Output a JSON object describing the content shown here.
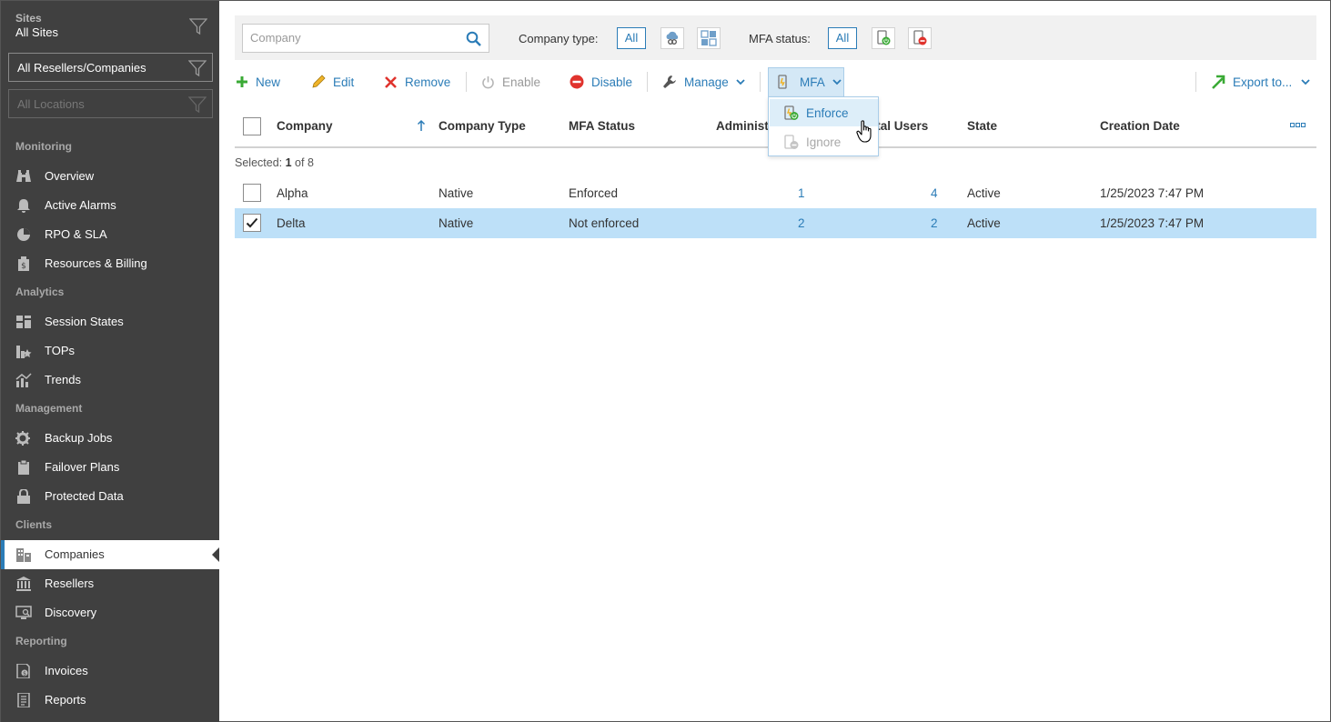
{
  "sidebar": {
    "sites_label": "Sites",
    "sites_value": "All Sites",
    "reseller_select": "All Resellers/Companies",
    "location_select": "All Locations",
    "sections": {
      "monitoring": "Monitoring",
      "analytics": "Analytics",
      "management": "Management",
      "clients": "Clients",
      "reporting": "Reporting"
    },
    "items": {
      "overview": "Overview",
      "active_alarms": "Active Alarms",
      "rpo_sla": "RPO & SLA",
      "resources_billing": "Resources & Billing",
      "session_states": "Session States",
      "tops": "TOPs",
      "trends": "Trends",
      "backup_jobs": "Backup Jobs",
      "failover_plans": "Failover Plans",
      "protected_data": "Protected Data",
      "companies": "Companies",
      "resellers": "Resellers",
      "discovery": "Discovery",
      "invoices": "Invoices",
      "reports": "Reports"
    },
    "active_item": "Companies"
  },
  "filters": {
    "search_placeholder": "Company",
    "company_type_label": "Company type:",
    "company_type_all": "All",
    "mfa_status_label": "MFA status:",
    "mfa_status_all": "All"
  },
  "toolbar": {
    "new": "New",
    "edit": "Edit",
    "remove": "Remove",
    "enable": "Enable",
    "disable": "Disable",
    "manage": "Manage",
    "mfa": "MFA",
    "export": "Export to..."
  },
  "mfa_menu": {
    "enforce": "Enforce",
    "ignore": "Ignore"
  },
  "table": {
    "headers": {
      "company": "Company",
      "company_type": "Company Type",
      "mfa_status": "MFA Status",
      "administrators": "Administ",
      "portal_users": "rtal Users",
      "state": "State",
      "creation_date": "Creation Date"
    },
    "selected_prefix": "Selected:",
    "selected_count": "1",
    "selected_suffix": "of 8",
    "rows": [
      {
        "company": "Alpha",
        "type": "Native",
        "mfa": "Enforced",
        "admins": "1",
        "users": "4",
        "state": "Active",
        "created": "1/25/2023 7:47 PM",
        "selected": false
      },
      {
        "company": "Delta",
        "type": "Native",
        "mfa": "Not enforced",
        "admins": "2",
        "users": "2",
        "state": "Active",
        "created": "1/25/2023 7:47 PM",
        "selected": true
      }
    ]
  },
  "colors": {
    "accent": "#2b7cb7",
    "sidebar_bg": "#404040",
    "selected_row": "#bde0f8",
    "green": "#3aaa35",
    "red": "#e0332d"
  }
}
